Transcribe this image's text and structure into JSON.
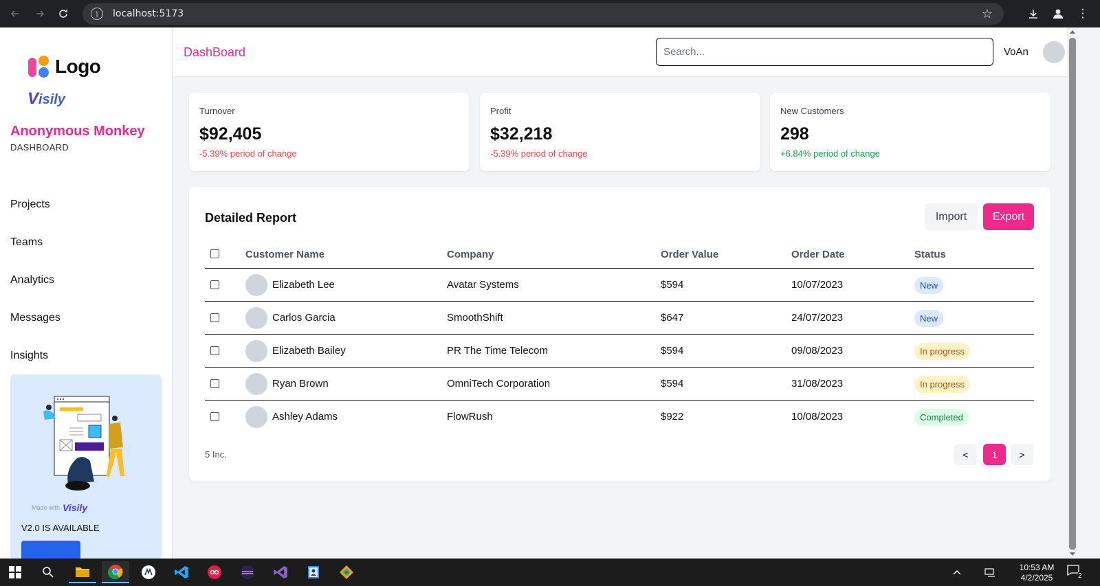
{
  "browser": {
    "url": "localhost:5173",
    "back_icon": "arrow-left-icon",
    "forward_icon": "arrow-right-icon",
    "reload_icon": "reload-icon"
  },
  "sidebar": {
    "logo_text": "Logo",
    "visily_text": "isily",
    "brand_name": "Anonymous Monkey",
    "brand_sub": "DASHBOARD",
    "nav": [
      "Projects",
      "Teams",
      "Analytics",
      "Messages",
      "Insights"
    ],
    "promo": {
      "made_with": "Made with",
      "made_with_brand": "isily",
      "title": "V2.0 IS AVAILABLE"
    }
  },
  "header": {
    "title": "DashBoard",
    "search_placeholder": "Search...",
    "username": "VoAn"
  },
  "stats": [
    {
      "label": "Turnover",
      "value": "$92,405",
      "delta": "-5.39% period of change",
      "trend": "negative"
    },
    {
      "label": "Profit",
      "value": "$32,218",
      "delta": "-5.39% period of change",
      "trend": "negative"
    },
    {
      "label": "New Customers",
      "value": "298",
      "delta": "+6.84% period of change",
      "trend": "positive"
    }
  ],
  "report": {
    "title": "Detailed Report",
    "import_label": "Import",
    "export_label": "Export",
    "columns": [
      "Customer Name",
      "Company",
      "Order Value",
      "Order Date",
      "Status"
    ],
    "rows": [
      {
        "name": "Elizabeth Lee",
        "company": "Avatar Systems",
        "value": "$594",
        "date": "10/07/2023",
        "status": "New",
        "status_type": "new"
      },
      {
        "name": "Carlos Garcia",
        "company": "SmoothShift",
        "value": "$647",
        "date": "24/07/2023",
        "status": "New",
        "status_type": "new"
      },
      {
        "name": "Elizabeth Bailey",
        "company": "PR The Time Telecom",
        "value": "$594",
        "date": "09/08/2023",
        "status": "In progress",
        "status_type": "progress"
      },
      {
        "name": "Ryan Brown",
        "company": "OmniTech Corporation",
        "value": "$594",
        "date": "31/08/2023",
        "status": "In progress",
        "status_type": "progress"
      },
      {
        "name": "Ashley Adams",
        "company": "FlowRush",
        "value": "$922",
        "date": "10/08/2023",
        "status": "Completed",
        "status_type": "done"
      }
    ],
    "footer_count": "5 Inc.",
    "pager": {
      "prev": "<",
      "current": "1",
      "next": ">"
    }
  },
  "taskbar": {
    "time": "10:53 AM",
    "date": "4/2/2025",
    "notification_count": "2"
  },
  "colors": {
    "accent": "#ec2a8c",
    "negative": "#ef4444",
    "positive": "#16a34a"
  }
}
